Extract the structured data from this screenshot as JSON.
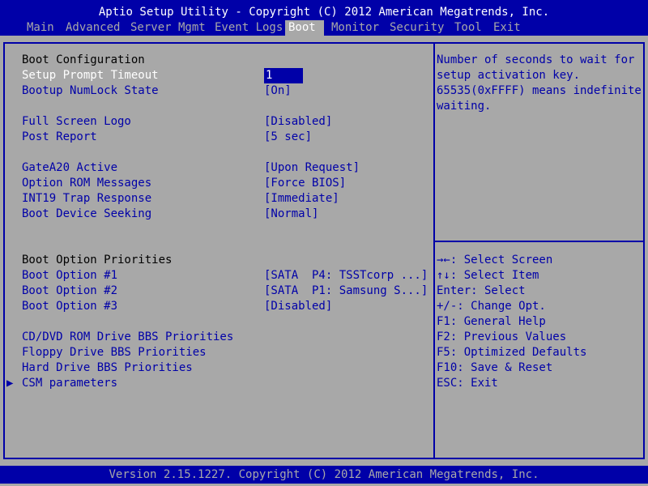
{
  "title": "Aptio Setup Utility - Copyright (C) 2012 American Megatrends, Inc.",
  "tabs": [
    "Main",
    "Advanced",
    "Server Mgmt",
    "Event Logs",
    "Boot",
    "Monitor",
    "Security",
    "Tool",
    "Exit"
  ],
  "active_tab": "Boot",
  "section_boot_configuration": "Boot Configuration",
  "settings": [
    {
      "label": "Setup Prompt Timeout",
      "value": "1"
    },
    {
      "label": "Bootup NumLock State",
      "value": "[On]"
    },
    {
      "label": "Full Screen Logo",
      "value": "[Disabled]"
    },
    {
      "label": "Post Report",
      "value": "[5 sec]"
    },
    {
      "label": "GateA20 Active",
      "value": "[Upon Request]"
    },
    {
      "label": "Option ROM Messages",
      "value": "[Force BIOS]"
    },
    {
      "label": "INT19 Trap Response",
      "value": "[Immediate]"
    },
    {
      "label": "Boot Device Seeking",
      "value": "[Normal]"
    }
  ],
  "section_boot_option_priorities": "Boot Option Priorities",
  "boot_options": [
    {
      "label": "Boot Option #1",
      "value": "[SATA  P4: TSSTcorp ...]"
    },
    {
      "label": "Boot Option #2",
      "value": "[SATA  P1: Samsung S...]"
    },
    {
      "label": "Boot Option #3",
      "value": "[Disabled]"
    }
  ],
  "submenus": [
    "CD/DVD ROM Drive BBS Priorities",
    "Floppy Drive BBS Priorities",
    "Hard Drive BBS Priorities",
    "CSM parameters"
  ],
  "help_text": [
    "Number of seconds to wait for",
    "setup activation key.",
    "65535(0xFFFF) means indefinite",
    "waiting."
  ],
  "key_help": [
    "→←: Select Screen",
    "↑↓: Select Item",
    "Enter: Select",
    "+/-: Change Opt.",
    "F1: General Help",
    "F2: Previous Values",
    "F5: Optimized Defaults",
    "F10: Save & Reset",
    "ESC: Exit"
  ],
  "footer": "Version 2.15.1227. Copyright (C) 2012 American Megatrends, Inc.",
  "colors": {
    "panel": "#a8a8a8",
    "accent": "#0000a8",
    "highlight": "#ffffff"
  }
}
